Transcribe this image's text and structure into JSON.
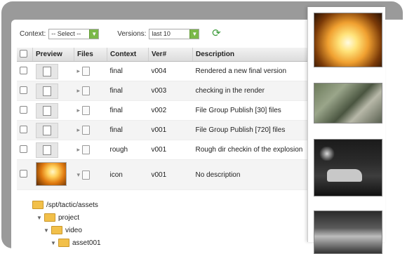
{
  "toolbar": {
    "context_label": "Context:",
    "context_value": "-- Select --",
    "versions_label": "Versions:",
    "versions_value": "last 10"
  },
  "columns": [
    "Preview",
    "Files",
    "Context",
    "Ver#",
    "Description"
  ],
  "rows": [
    {
      "context": "final",
      "version": "v004",
      "description": "Rendered a new final version"
    },
    {
      "context": "final",
      "version": "v003",
      "description": "checking in the render"
    },
    {
      "context": "final",
      "version": "v002",
      "description": "File Group Publish [30] files"
    },
    {
      "context": "final",
      "version": "v001",
      "description": "File Group Publish [720] files"
    },
    {
      "context": "rough",
      "version": "v001",
      "description": "Rough dir checkin of the explosion"
    },
    {
      "context": "icon",
      "version": "v001",
      "description": "No description"
    }
  ],
  "tree": [
    "/spt/tactic/assets",
    "project",
    "video",
    "asset001"
  ],
  "icons": {
    "refresh": "refresh-icon",
    "dropdown": "chevron-down-icon",
    "folder": "folder-icon",
    "document": "document-icon"
  },
  "colors": {
    "accent_green": "#7bb84a",
    "frame_gray": "#9a9a9a",
    "folder_yellow": "#f2c04a"
  }
}
